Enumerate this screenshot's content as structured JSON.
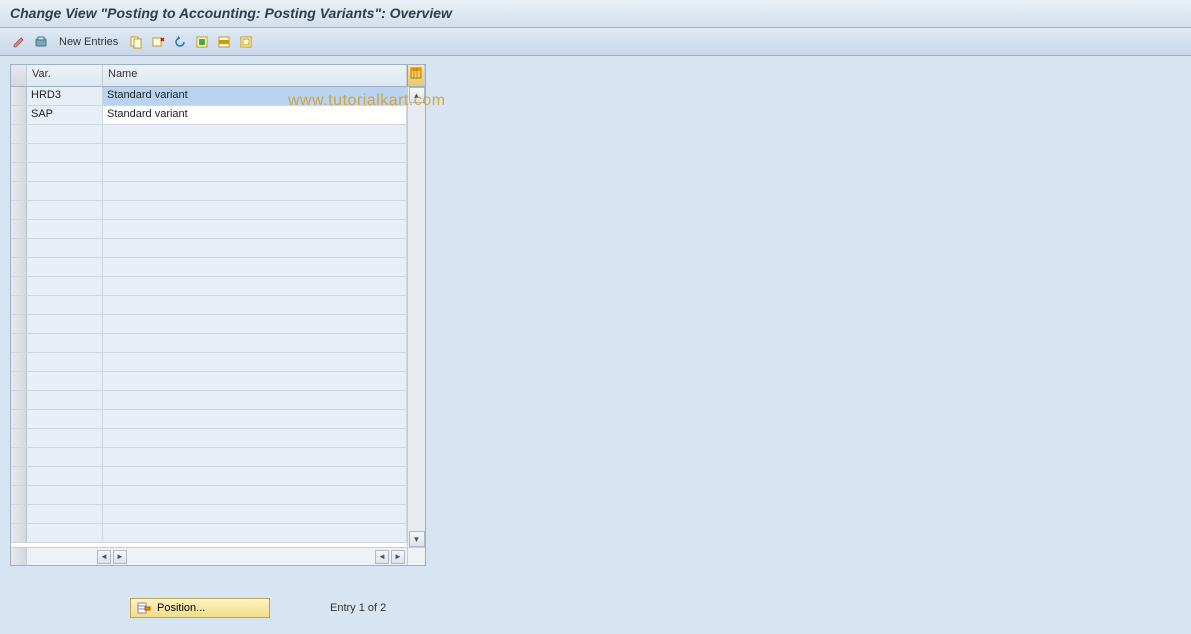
{
  "title": "Change View \"Posting to Accounting: Posting Variants\": Overview",
  "toolbar": {
    "new_entries": "New Entries"
  },
  "watermark": "www.tutorialkart.com",
  "columns": {
    "var": "Var.",
    "name": "Name"
  },
  "rows": [
    {
      "var": "HRD3",
      "name": "Standard variant",
      "selected": true
    },
    {
      "var": "SAP",
      "name": "Standard variant",
      "selected": false
    }
  ],
  "position_label": "Position...",
  "entry_text": "Entry 1 of 2"
}
